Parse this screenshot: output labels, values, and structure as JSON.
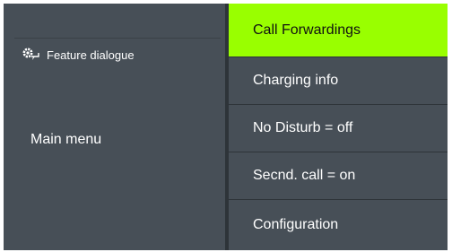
{
  "left_panel": {
    "feature_label": "Feature dialogue",
    "feature_icon": "gear-speech-bubble-icon",
    "main_menu_label": "Main menu"
  },
  "menu": {
    "items": [
      {
        "label": "Call Forwardings",
        "selected": true
      },
      {
        "label": "Charging info",
        "selected": false
      },
      {
        "label": "No Disturb = off",
        "selected": false
      },
      {
        "label": "Secnd. call = on",
        "selected": false
      },
      {
        "label": "Configuration",
        "selected": false
      }
    ]
  },
  "colors": {
    "selected_bg": "#99ff00",
    "item_bg": "#474f57",
    "separator": "#2e3439",
    "text": "#ffffff"
  }
}
